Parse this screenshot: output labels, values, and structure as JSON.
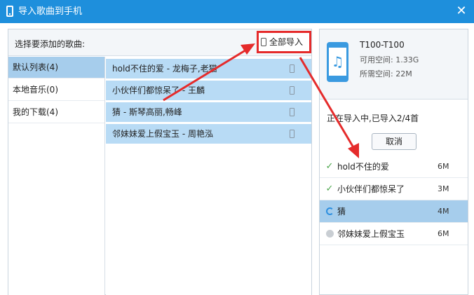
{
  "window": {
    "title": "导入歌曲到手机",
    "close_icon": "close-icon"
  },
  "left": {
    "header_label": "选择要添加的歌曲:",
    "import_all_label": "全部导入",
    "categories": [
      {
        "label": "默认列表(4)",
        "selected": true
      },
      {
        "label": "本地音乐(0)",
        "selected": false
      },
      {
        "label": "我的下载(4)",
        "selected": false
      }
    ],
    "songs": [
      "hold不住的爱 - 龙梅子,老猫",
      "小伙伴们都惊呆了 - 王麟",
      "猜 - 斯琴高丽,畅峰",
      "邻妹妹爱上假宝玉 - 周艳泓"
    ]
  },
  "device": {
    "name": "T100-T100",
    "free_space": "可用空间: 1.33G",
    "needed_space": "所需空间: 22M"
  },
  "import": {
    "status": "正在导入中,已导入2/4首",
    "cancel_label": "取消",
    "queue": [
      {
        "name": "hold不住的爱",
        "size": "6M",
        "state": "done",
        "icon": "check-icon"
      },
      {
        "name": "小伙伴们都惊呆了",
        "size": "3M",
        "state": "done",
        "icon": "check-icon"
      },
      {
        "name": "猜",
        "size": "4M",
        "state": "importing",
        "icon": "loading-spinner-icon"
      },
      {
        "name": "邻妹妹爱上假宝玉",
        "size": "6M",
        "state": "waiting",
        "icon": "clock-icon"
      }
    ]
  },
  "colors": {
    "titlebar": "#1e8fdc",
    "highlight": "#e52b2b",
    "selection": "#a6cdec",
    "song_row": "#b8dbf5"
  }
}
